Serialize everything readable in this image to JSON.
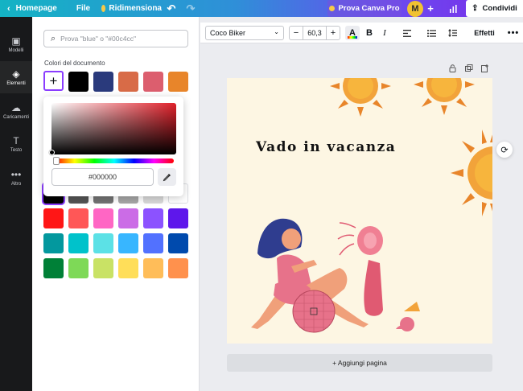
{
  "topbar": {
    "home_label": "Homepage",
    "file_label": "File",
    "resize_label": "Ridimensiona",
    "pro_label": "Prova Canva Pro",
    "avatar_initial": "M",
    "share_label": "Condividi"
  },
  "rail": {
    "items": [
      {
        "label": "Modelli",
        "icon": "templates-icon"
      },
      {
        "label": "Elementi",
        "icon": "elements-icon"
      },
      {
        "label": "Caricamenti",
        "icon": "upload-icon"
      },
      {
        "label": "Testo",
        "icon": "text-icon"
      },
      {
        "label": "Altro",
        "icon": "more-icon"
      }
    ]
  },
  "panel": {
    "search_placeholder": "Prova \"blue\" o \"#00c4cc\"",
    "doc_colors_label": "Colori del documento",
    "doc_colors": [
      "#000000",
      "#2a3a7c",
      "#d86b47",
      "#dc5e6e",
      "#e8852a"
    ],
    "default_colors": [
      [
        "#000000",
        "#545454",
        "#737373",
        "#a6a6a6",
        "#d9d9d9",
        "#ffffff"
      ],
      [
        "#ff1616",
        "#ff5757",
        "#ff66c4",
        "#cb6ce6",
        "#8c52ff",
        "#5e17eb"
      ],
      [
        "#03989e",
        "#00c2cb",
        "#5ce1e6",
        "#38b6ff",
        "#5271ff",
        "#004aad"
      ],
      [
        "#008037",
        "#7ed957",
        "#c9e265",
        "#ffde59",
        "#ffbd59",
        "#ff914d"
      ]
    ]
  },
  "picker": {
    "hex_value": "#000000"
  },
  "toolbar": {
    "font_name": "Coco Biker",
    "font_size": "60,3",
    "effects_label": "Effetti"
  },
  "canvas": {
    "title_text": "Vado in vacanza",
    "add_page_label": "+ Aggiungi pagina"
  }
}
